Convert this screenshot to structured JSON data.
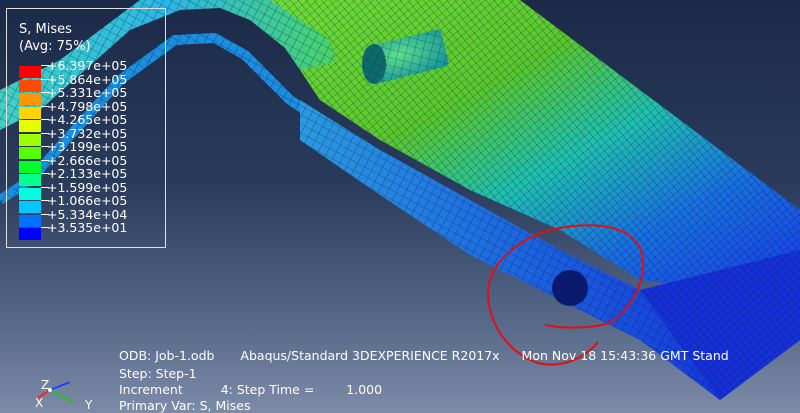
{
  "legend": {
    "title_line1": "S, Mises",
    "title_line2": "(Avg: 75%)",
    "entries": [
      {
        "label": "+6.397e+05",
        "color": "#ff0000"
      },
      {
        "label": "+5.864e+05",
        "color": "#ff4b00"
      },
      {
        "label": "+5.331e+05",
        "color": "#ff9500"
      },
      {
        "label": "+4.798e+05",
        "color": "#ffd500"
      },
      {
        "label": "+4.265e+05",
        "color": "#e3ff00"
      },
      {
        "label": "+3.732e+05",
        "color": "#9dff00"
      },
      {
        "label": "+3.199e+05",
        "color": "#55ff00"
      },
      {
        "label": "+2.666e+05",
        "color": "#00ff2a"
      },
      {
        "label": "+2.133e+05",
        "color": "#00ff8c"
      },
      {
        "label": "+1.599e+05",
        "color": "#00ffe0"
      },
      {
        "label": "+1.066e+05",
        "color": "#00c8ff"
      },
      {
        "label": "+5.334e+04",
        "color": "#0070ff"
      },
      {
        "label": "+3.535e+01",
        "color": "#0000ff"
      }
    ]
  },
  "info": {
    "odb_label": "ODB: Job-1.odb",
    "solver": "Abaqus/Standard 3DEXPERIENCE R2017x",
    "timestamp": "Mon Nov 18 15:43:36 GMT Stand",
    "step": "Step: Step-1",
    "increment_label": "Increment",
    "increment_value": "4: Step Time =",
    "step_time": "1.000",
    "primary_var": "Primary Var: S, Mises"
  },
  "triad": {
    "x": "X",
    "y": "Y",
    "z": "Z"
  }
}
